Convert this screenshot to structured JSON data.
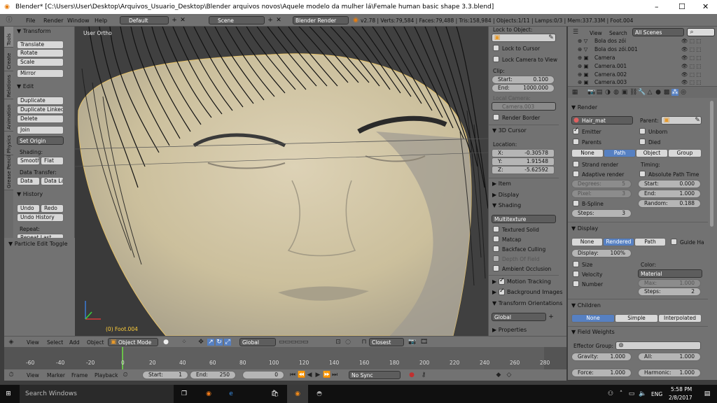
{
  "title_bar": {
    "title": "Blender* [C:\\Users\\User\\Desktop\\Arquivos_Usuario_Desktop\\Blender arquivos novos\\Aquele modelo da mulher lá\\Female human basic shape 3.3.blend]",
    "minimize": "–",
    "maximize": "☐",
    "close": "✕"
  },
  "info_header": {
    "menus": [
      "File",
      "Render",
      "Window",
      "Help"
    ],
    "layout": "Default",
    "scene": "Scene",
    "engine": "Blender Render",
    "stats": "v2.78 | Verts:79,584 | Faces:79,488 | Tris:158,984 | Objects:1/11 | Lamps:0/3 | Mem:337.33M | Foot.004"
  },
  "left_tabs": [
    "Tools",
    "Create",
    "Relations",
    "Animation",
    "Physics",
    "Grease Pencil"
  ],
  "tool_shelf": {
    "transform_header": "Transform",
    "translate": "Translate",
    "rotate": "Rotate",
    "scale": "Scale",
    "mirror": "Mirror",
    "edit_header": "Edit",
    "duplicate": "Duplicate",
    "duplicate_linked": "Duplicate Linked",
    "delete": "Delete",
    "join": "Join",
    "set_origin": "Set Origin",
    "shading_label": "Shading:",
    "smooth": "Smooth",
    "flat": "Flat",
    "data_transfer_label": "Data Transfer:",
    "data": "Data",
    "data_layout": "Data La",
    "history_header": "History",
    "undo": "Undo",
    "redo": "Redo",
    "undo_history": "Undo History",
    "repeat_label": "Repeat:",
    "repeat_last": "Repeat Last",
    "particle_edit_toggle": "Particle Edit Toggle"
  },
  "viewport": {
    "view_label": "User Ortho",
    "object_label": "(0) Foot.004"
  },
  "n_panel": {
    "lock_to_object_label": "Lock to Object:",
    "lock_to_cursor": "Lock to Cursor",
    "lock_camera_to_view": "Lock Camera to View",
    "clip_label": "Clip:",
    "clip_start_label": "Start:",
    "clip_start": "0.100",
    "clip_end_label": "End:",
    "clip_end": "1000.000",
    "local_camera_label": "Local Camera:",
    "local_camera": "Camera.003",
    "render_border": "Render Border",
    "cursor_header": "3D Cursor",
    "location_label": "Location:",
    "x_label": "X:",
    "x": "-0.30578",
    "y_label": "Y:",
    "y": "1.91548",
    "z_label": "Z:",
    "z": "-5.62592",
    "item_header": "Item",
    "display_header": "Display",
    "shading_header": "Shading",
    "shading_mode": "Multitexture",
    "textured_solid": "Textured Solid",
    "matcap": "Matcap",
    "backface_culling": "Backface Culling",
    "depth_of_field": "Depth Of Field",
    "ambient_occlusion": "Ambient Occlusion",
    "motion_tracking_header": "Motion Tracking",
    "background_images_header": "Background Images",
    "transform_orientations_header": "Transform Orientations",
    "orientation": "Global",
    "properties_header": "Properties"
  },
  "outliner": {
    "view": "View",
    "search": "Search",
    "scenes": "All Scenes",
    "items": [
      "Bola dos zói",
      "Bola dos zói.001",
      "Camera",
      "Camera.001",
      "Camera.002",
      "Camera.003"
    ]
  },
  "properties": {
    "render_header": "Render",
    "material": "Hair_mat",
    "parent_label": "Parent:",
    "emitter": "Emitter",
    "unborn": "Unborn",
    "parents": "Parents",
    "died": "Died",
    "render_as": [
      "None",
      "Path",
      "Object",
      "Group"
    ],
    "strand_render": "Strand render",
    "timing_label": "Timing:",
    "adaptive_render": "Adaptive render",
    "absolute_path_time": "Absolute Path Time",
    "degrees_label": "Degrees:",
    "degrees": "5",
    "start_label": "Start:",
    "start": "0.000",
    "pixel_label": "Pixel:",
    "pixel": "3",
    "end_label": "End:",
    "end": "1.000",
    "b_spline": "B-Spline",
    "random_label": "Random:",
    "random": "0.188",
    "steps_label": "Steps:",
    "steps": "3",
    "display_header": "Display",
    "display_as": [
      "None",
      "Rendered",
      "Path"
    ],
    "guide_hair": "Guide Ha",
    "display_label": "Display:",
    "display_pct": "100%",
    "size": "Size",
    "color_label": "Color:",
    "velocity": "Velocity",
    "color_mode": "Material",
    "number": "Number",
    "max_label": "Max:",
    "max": "1.000",
    "disp_steps_label": "Steps:",
    "disp_steps": "2",
    "children_header": "Children",
    "children_modes": [
      "None",
      "Simple",
      "Interpolated"
    ],
    "field_weights_header": "Field Weights",
    "effector_group_label": "Effector Group:",
    "gravity_label": "Gravity:",
    "gravity": "1.000",
    "all_label": "All:",
    "all": "1.000",
    "force_label": "Force:",
    "force": "1.000",
    "harmonic_label": "Harmonic:",
    "harmonic": "1.000"
  },
  "view3d_header": {
    "view": "View",
    "select": "Select",
    "add": "Add",
    "object": "Object",
    "mode": "Object Mode",
    "orientation": "Global",
    "snap": "Closest"
  },
  "timeline": {
    "ticks": [
      "-60",
      "-40",
      "-20",
      "0",
      "20",
      "40",
      "60",
      "80",
      "100",
      "120",
      "140",
      "160",
      "180",
      "200",
      "220",
      "240",
      "260",
      "280"
    ],
    "view": "View",
    "marker": "Marker",
    "frame": "Frame",
    "playback": "Playback",
    "start_label": "Start:",
    "start": "1",
    "end_label": "End:",
    "end": "250",
    "current": "0",
    "sync": "No Sync"
  },
  "taskbar": {
    "search": "Search Windows",
    "lang": "ENG",
    "time": "5:58 PM",
    "date": "2/8/2017"
  }
}
